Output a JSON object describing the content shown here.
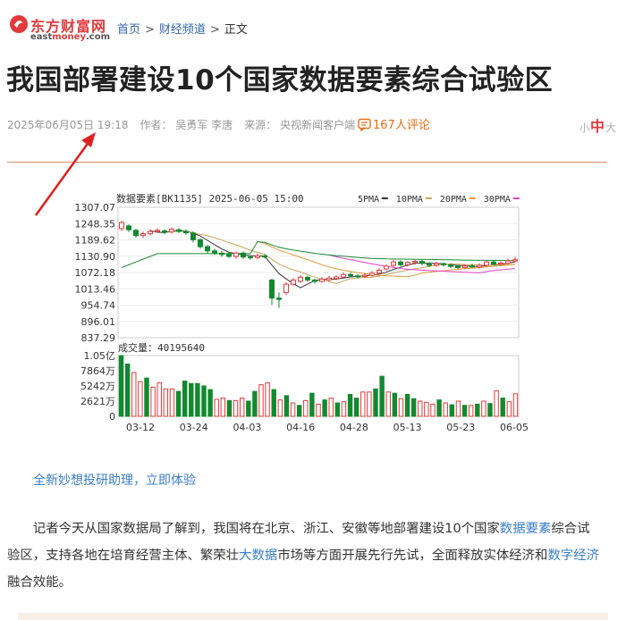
{
  "logo": {
    "cn": "东方财富网",
    "en_a": "east",
    "en_b": "money",
    "en_c": ".com"
  },
  "breadcrumb": {
    "home": "首页",
    "channel": "财经频道",
    "current": "正文",
    "sep": ">"
  },
  "article": {
    "title": "我国部署建设10个国家数据要素综合试验区",
    "date": "2025年06月05日 19:18",
    "author": "作者：  吴勇军 李唐",
    "source": "来源：  央视新闻客户端",
    "comments": "167人评论",
    "font_small": "小",
    "font_mid": "中",
    "font_large": "大"
  },
  "promo_link": "全新妙想投研助理，立即体验",
  "paragraph": {
    "p1": "记者今天从国家数据局了解到，我国将在北京、浙江、安徽等地部署建设10个国家",
    "link1": "数据要素",
    "p2": "综合试验区，支持各地在培育经营主体、繁荣壮",
    "link2": "大数据",
    "p3": "市场等方面开展先行先试，全面释放实体经济和",
    "link3": "数字经济",
    "p4": "融合效能。"
  },
  "colors": {
    "up": "#e4393c",
    "down": "#13892f",
    "ma5": "#333333",
    "ma10": "#c8a85a",
    "ma20": "#e29a33",
    "ma30": "#e040c8",
    "ma60": "#1a8a3a",
    "link": "#3a7ec9",
    "brand": "#e4393c"
  },
  "chart_data": {
    "type": "candlestick",
    "header": "数据要素[BK1135] 2025-06-05 15:00",
    "legend": [
      "5PMA",
      "10PMA",
      "20PMA",
      "30PMA"
    ],
    "price_ticks": [
      "1307.07",
      "1248.35",
      "1189.62",
      "1130.90",
      "1072.18",
      "1013.46",
      "954.74",
      "896.01",
      "837.29"
    ],
    "volume_label": "成交量：40195640",
    "volume_ticks": [
      "1.05亿",
      "7864万",
      "5242万",
      "2621万",
      "0"
    ],
    "date_labels": [
      "03-12",
      "03-24",
      "04-03",
      "04-16",
      "04-28",
      "05-13",
      "05-23",
      "06-05"
    ],
    "ylim": [
      837.29,
      1307.07
    ],
    "candles": [
      [
        1230,
        1252,
        1258,
        1222
      ],
      [
        1240,
        1226,
        1245,
        1218
      ],
      [
        1224,
        1205,
        1230,
        1198
      ],
      [
        1205,
        1212,
        1220,
        1196
      ],
      [
        1212,
        1220,
        1228,
        1205
      ],
      [
        1220,
        1224,
        1232,
        1214
      ],
      [
        1222,
        1218,
        1228,
        1210
      ],
      [
        1218,
        1228,
        1234,
        1212
      ],
      [
        1226,
        1220,
        1232,
        1214
      ],
      [
        1220,
        1215,
        1228,
        1208
      ],
      [
        1214,
        1190,
        1220,
        1180
      ],
      [
        1190,
        1165,
        1195,
        1158
      ],
      [
        1165,
        1150,
        1172,
        1140
      ],
      [
        1150,
        1142,
        1158,
        1135
      ],
      [
        1142,
        1137,
        1150,
        1128
      ],
      [
        1137,
        1130,
        1145,
        1125
      ],
      [
        1130,
        1142,
        1148,
        1122
      ],
      [
        1142,
        1128,
        1148,
        1120
      ],
      [
        1128,
        1126,
        1135,
        1118
      ],
      [
        1126,
        1132,
        1140,
        1120
      ],
      [
        1132,
        1128,
        1138,
        1122
      ],
      [
        1045,
        980,
        1050,
        955
      ],
      [
        980,
        975,
        1000,
        945
      ],
      [
        1000,
        1030,
        1038,
        990
      ],
      [
        1030,
        1045,
        1052,
        1025
      ],
      [
        1040,
        1055,
        1062,
        1034
      ],
      [
        1055,
        1045,
        1060,
        1038
      ],
      [
        1045,
        1040,
        1050,
        1032
      ],
      [
        1040,
        1048,
        1056,
        1036
      ],
      [
        1046,
        1052,
        1060,
        1040
      ],
      [
        1050,
        1056,
        1062,
        1044
      ],
      [
        1056,
        1065,
        1072,
        1050
      ],
      [
        1065,
        1060,
        1072,
        1054
      ],
      [
        1060,
        1058,
        1066,
        1050
      ],
      [
        1058,
        1062,
        1070,
        1052
      ],
      [
        1062,
        1070,
        1078,
        1056
      ],
      [
        1070,
        1080,
        1088,
        1064
      ],
      [
        1085,
        1095,
        1102,
        1078
      ],
      [
        1098,
        1110,
        1118,
        1092
      ],
      [
        1110,
        1100,
        1116,
        1094
      ],
      [
        1100,
        1108,
        1114,
        1094
      ],
      [
        1108,
        1112,
        1120,
        1100
      ],
      [
        1112,
        1105,
        1118,
        1098
      ],
      [
        1105,
        1098,
        1110,
        1092
      ],
      [
        1098,
        1104,
        1110,
        1092
      ],
      [
        1104,
        1100,
        1108,
        1094
      ],
      [
        1100,
        1094,
        1106,
        1088
      ],
      [
        1094,
        1090,
        1100,
        1084
      ],
      [
        1090,
        1096,
        1102,
        1084
      ],
      [
        1096,
        1092,
        1104,
        1088
      ],
      [
        1092,
        1098,
        1106,
        1086
      ],
      [
        1098,
        1110,
        1118,
        1092
      ],
      [
        1110,
        1102,
        1116,
        1098
      ],
      [
        1102,
        1106,
        1112,
        1096
      ],
      [
        1106,
        1114,
        1122,
        1100
      ],
      [
        1114,
        1118,
        1128,
        1108
      ]
    ],
    "volumes": [
      [
        1.0,
        "d"
      ],
      [
        0.86,
        "d"
      ],
      [
        0.72,
        "u"
      ],
      [
        0.57,
        "u"
      ],
      [
        0.63,
        "d"
      ],
      [
        0.48,
        "u"
      ],
      [
        0.55,
        "u"
      ],
      [
        0.45,
        "u"
      ],
      [
        0.45,
        "u"
      ],
      [
        0.41,
        "d"
      ],
      [
        0.58,
        "d"
      ],
      [
        0.54,
        "d"
      ],
      [
        0.54,
        "d"
      ],
      [
        0.5,
        "d"
      ],
      [
        0.44,
        "d"
      ],
      [
        0.28,
        "u"
      ],
      [
        0.3,
        "u"
      ],
      [
        0.26,
        "d"
      ],
      [
        0.26,
        "u"
      ],
      [
        0.3,
        "u"
      ],
      [
        0.25,
        "d"
      ],
      [
        0.41,
        "d"
      ],
      [
        0.52,
        "u"
      ],
      [
        0.55,
        "u"
      ],
      [
        0.44,
        "d"
      ],
      [
        0.27,
        "u"
      ],
      [
        0.34,
        "d"
      ],
      [
        0.22,
        "u"
      ],
      [
        0.18,
        "d"
      ],
      [
        0.26,
        "u"
      ],
      [
        0.38,
        "d"
      ],
      [
        0.2,
        "u"
      ],
      [
        0.27,
        "d"
      ],
      [
        0.3,
        "u"
      ],
      [
        0.22,
        "d"
      ],
      [
        0.24,
        "u"
      ],
      [
        0.36,
        "d"
      ],
      [
        0.3,
        "d"
      ],
      [
        0.4,
        "u"
      ],
      [
        0.4,
        "u"
      ],
      [
        0.45,
        "d"
      ],
      [
        0.66,
        "d"
      ],
      [
        0.4,
        "u"
      ],
      [
        0.38,
        "d"
      ],
      [
        0.29,
        "u"
      ],
      [
        0.36,
        "d"
      ],
      [
        0.29,
        "d"
      ],
      [
        0.25,
        "u"
      ],
      [
        0.23,
        "u"
      ],
      [
        0.2,
        "u"
      ],
      [
        0.27,
        "d"
      ],
      [
        0.22,
        "u"
      ],
      [
        0.19,
        "d"
      ],
      [
        0.25,
        "u"
      ],
      [
        0.18,
        "d"
      ],
      [
        0.18,
        "u"
      ],
      [
        0.2,
        "d"
      ],
      [
        0.25,
        "u"
      ],
      [
        0.21,
        "d"
      ],
      [
        0.42,
        "u"
      ],
      [
        0.3,
        "d"
      ],
      [
        0.24,
        "u"
      ],
      [
        0.37,
        "u"
      ]
    ]
  }
}
